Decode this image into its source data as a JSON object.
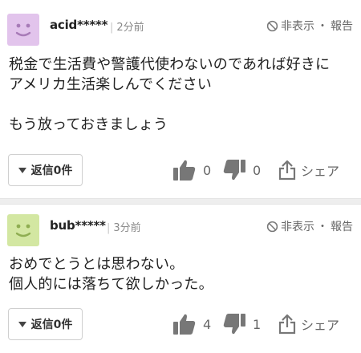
{
  "colors": {
    "avatar1": "#e2c4ec",
    "avatar1_face": "#a87bb8",
    "avatar2": "#d3e7a2",
    "avatar2_face": "#8fae52",
    "icon": "#777777"
  },
  "comments": [
    {
      "username": "acid*****",
      "time": "2分前",
      "hide_label": "非表示",
      "separator": "・",
      "report_label": "報告",
      "body": "税金で生活費や警護代使わないのであれば好きに\nアメリカ生活楽しんでください\n\nもう放っておきましょう",
      "reply_label": "返信",
      "reply_count": "0件",
      "likes": "0",
      "dislikes": "0",
      "share_label": "シェア"
    },
    {
      "username": "bub*****",
      "time": "3分前",
      "hide_label": "非表示",
      "separator": "・",
      "report_label": "報告",
      "body": "おめでとうとは思わない。\n個人的には落ちて欲しかった。",
      "reply_label": "返信",
      "reply_count": "0件",
      "likes": "4",
      "dislikes": "1",
      "share_label": "シェア"
    }
  ]
}
